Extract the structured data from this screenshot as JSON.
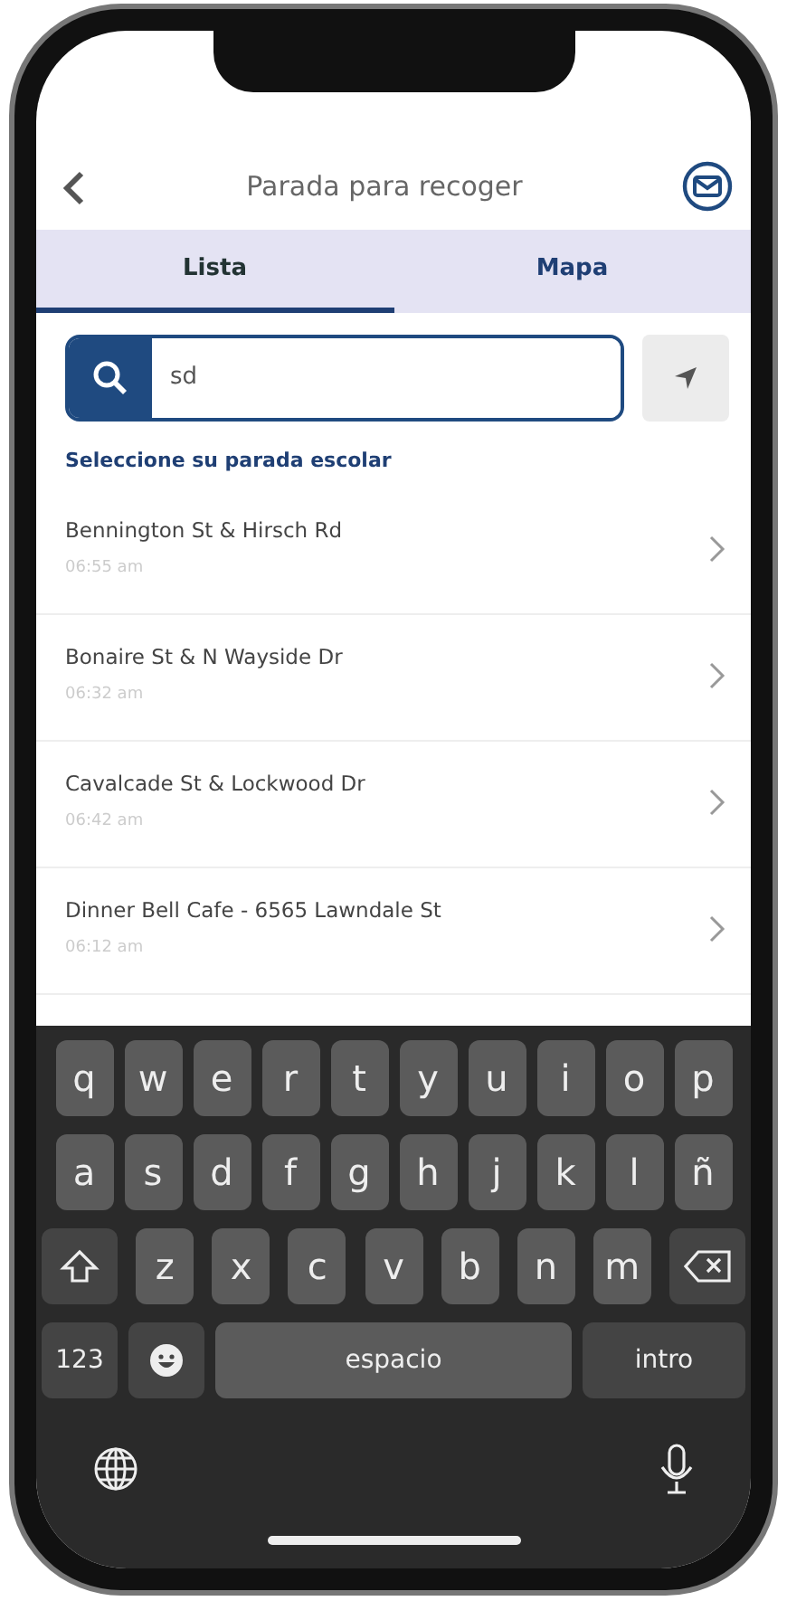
{
  "header": {
    "title": "Parada para recoger"
  },
  "tabs": [
    {
      "label": "Lista",
      "selected": true
    },
    {
      "label": "Mapa",
      "selected": false
    }
  ],
  "search": {
    "value": "sd"
  },
  "section_label": "Seleccione su parada escolar",
  "stops": [
    {
      "name": "Bennington St & Hirsch Rd",
      "time": "06:55 am"
    },
    {
      "name": "Bonaire St & N Wayside Dr",
      "time": "06:32 am"
    },
    {
      "name": "Cavalcade St & Lockwood Dr",
      "time": "06:42 am"
    },
    {
      "name": "Dinner Bell Cafe - 6565 Lawndale St",
      "time": "06:12 am"
    }
  ],
  "keyboard": {
    "top_row": [
      {
        "kind": "char",
        "label": "q"
      },
      {
        "kind": "char",
        "label": "w"
      },
      {
        "kind": "char",
        "label": "e"
      },
      {
        "kind": "char",
        "label": "r"
      },
      {
        "kind": "char",
        "label": "t"
      },
      {
        "kind": "char",
        "label": "y"
      },
      {
        "kind": "char",
        "label": "u"
      },
      {
        "kind": "char",
        "label": "i"
      },
      {
        "kind": "char",
        "label": "o"
      },
      {
        "kind": "char",
        "label": "p"
      }
    ],
    "middle_row": [
      {
        "kind": "char",
        "label": "a"
      },
      {
        "kind": "char",
        "label": "s"
      },
      {
        "kind": "char",
        "label": "d"
      },
      {
        "kind": "char",
        "label": "f"
      },
      {
        "kind": "char",
        "label": "g"
      },
      {
        "kind": "char",
        "label": "h"
      },
      {
        "kind": "char",
        "label": "j"
      },
      {
        "kind": "char",
        "label": "k"
      },
      {
        "kind": "char",
        "label": "l"
      },
      {
        "kind": "char",
        "label": "ñ"
      }
    ],
    "bottom_letter_row": [
      {
        "kind": "shift"
      },
      {
        "kind": "char",
        "label": "z"
      },
      {
        "kind": "char",
        "label": "x"
      },
      {
        "kind": "char",
        "label": "c"
      },
      {
        "kind": "char",
        "label": "v"
      },
      {
        "kind": "char",
        "label": "b"
      },
      {
        "kind": "char",
        "label": "n"
      },
      {
        "kind": "char",
        "label": "m"
      },
      {
        "kind": "backspace"
      }
    ],
    "function_row": [
      {
        "kind": "mode",
        "label": "123"
      },
      {
        "kind": "emoji"
      },
      {
        "kind": "space",
        "label": "espacio"
      },
      {
        "kind": "return",
        "label": "intro"
      }
    ]
  }
}
